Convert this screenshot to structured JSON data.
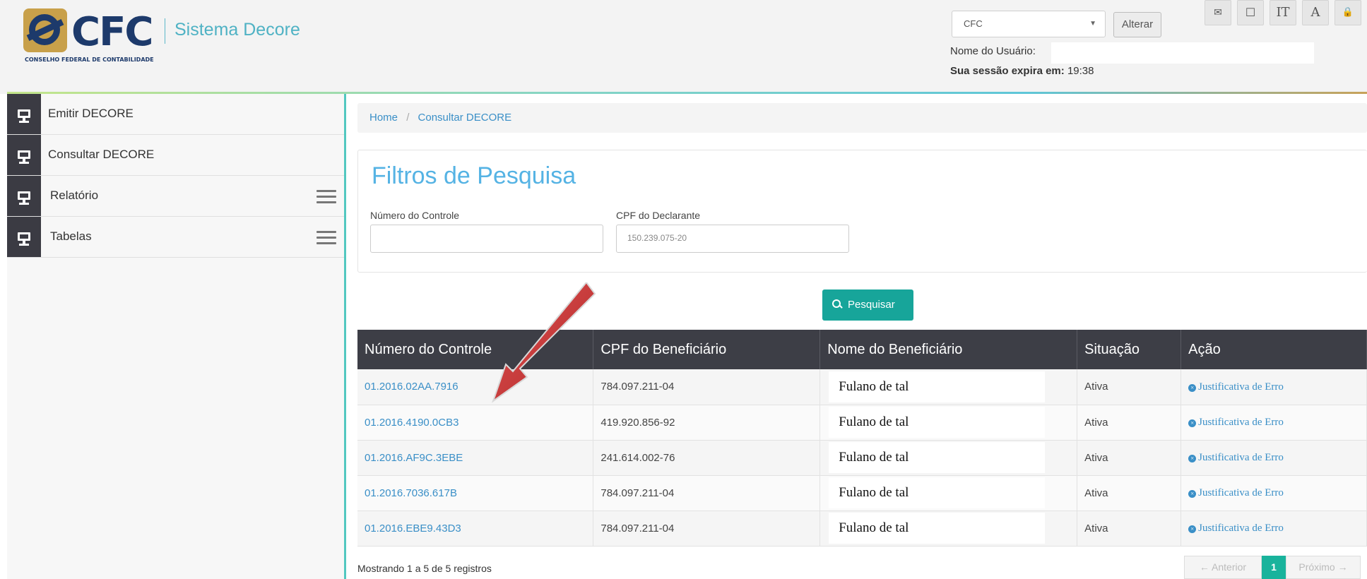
{
  "header": {
    "logo_text": "CFC",
    "logo_subtitle": "CONSELHO FEDERAL DE CONTABILIDADE",
    "app_name": "Sistema Decore",
    "org_select_value": "CFC",
    "alter_button": "Alterar",
    "user_label": "Nome do Usuário:",
    "session_label": "Sua sessão expira em:",
    "session_time": "19:38",
    "tools": [
      {
        "icon": "envelope-icon",
        "glyph": "✉"
      },
      {
        "icon": "window-icon",
        "glyph": "☐"
      },
      {
        "icon": "text-size-icon",
        "glyph": "ΙT"
      },
      {
        "icon": "font-icon",
        "glyph": "A"
      },
      {
        "icon": "lock-icon",
        "glyph": "🔒"
      }
    ]
  },
  "sidebar": {
    "items": [
      {
        "label": "Emitir DECORE",
        "submenu": false
      },
      {
        "label": "Consultar DECORE",
        "submenu": false
      },
      {
        "label": "Relatório",
        "submenu": true
      },
      {
        "label": "Tabelas",
        "submenu": true
      }
    ]
  },
  "breadcrumb": {
    "home": "Home",
    "separator": "/",
    "current": "Consultar DECORE"
  },
  "filters": {
    "title": "Filtros de Pesquisa",
    "control_label": "Número do Controle",
    "control_value": "",
    "cpf_label": "CPF do Declarante",
    "cpf_value": "150.239.075-20",
    "search_button": "Pesquisar"
  },
  "table": {
    "headers": [
      "Número do Controle",
      "CPF do Beneficiário",
      "Nome do Beneficiário",
      "Situação",
      "Ação"
    ],
    "rows": [
      {
        "control": "01.2016.02AA.7916",
        "cpf": "784.097.211-04",
        "name": "Fulano de tal",
        "status": "Ativa",
        "action": "Justificativa de Erro"
      },
      {
        "control": "01.2016.4190.0CB3",
        "cpf": "419.920.856-92",
        "name": "Fulano de tal",
        "status": "Ativa",
        "action": "Justificativa de Erro"
      },
      {
        "control": "01.2016.AF9C.3EBE",
        "cpf": "241.614.002-76",
        "name": "Fulano de tal",
        "status": "Ativa",
        "action": "Justificativa de Erro"
      },
      {
        "control": "01.2016.7036.617B",
        "cpf": "784.097.211-04",
        "name": "Fulano de tal",
        "status": "Ativa",
        "action": "Justificativa de Erro"
      },
      {
        "control": "01.2016.EBE9.43D3",
        "cpf": "784.097.211-04",
        "name": "Fulano de tal",
        "status": "Ativa",
        "action": "Justificativa de Erro"
      }
    ]
  },
  "footer": {
    "info": "Mostrando 1 a 5 de 5 registros",
    "prev": "← Anterior",
    "current_page": "1",
    "next": "Próximo →"
  },
  "colors": {
    "accent_teal": "#17a59a",
    "link_blue": "#3a8fc7",
    "title_blue": "#55b3e4",
    "table_header": "#3d3e46",
    "annotation_arrow": "#c8373a"
  }
}
